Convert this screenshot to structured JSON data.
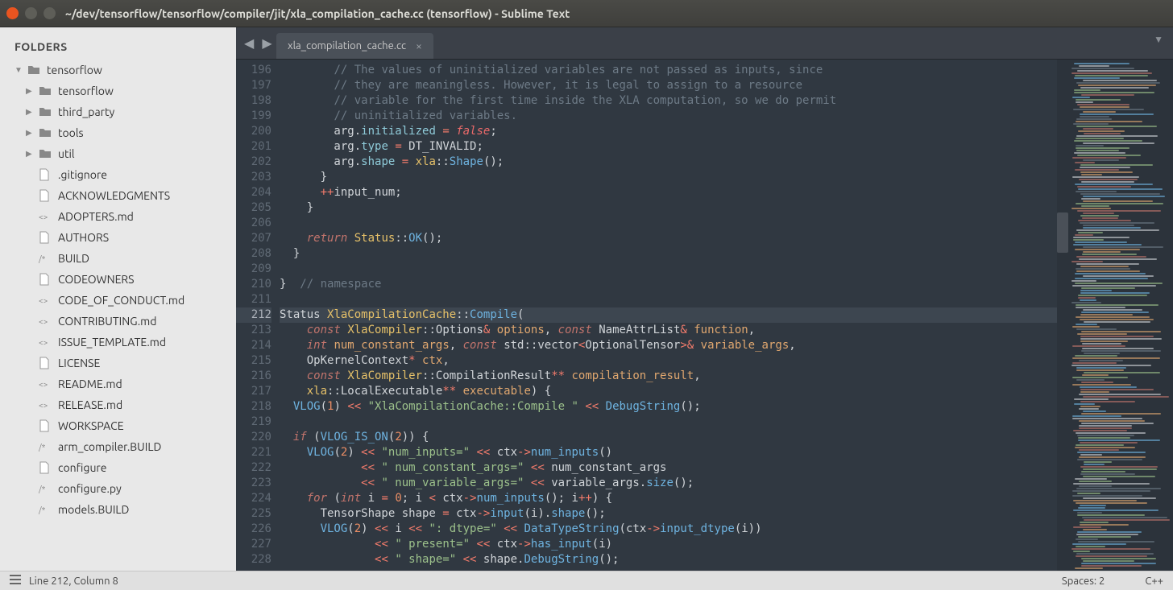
{
  "titlebar": {
    "text": "~/dev/tensorflow/tensorflow/compiler/jit/xla_compilation_cache.cc (tensorflow) - Sublime Text"
  },
  "sidebar": {
    "heading": "FOLDERS",
    "root": "tensorflow",
    "folders": [
      "tensorflow",
      "third_party",
      "tools",
      "util"
    ],
    "files": [
      {
        "name": ".gitignore",
        "icon": "file"
      },
      {
        "name": "ACKNOWLEDGMENTS",
        "icon": "file"
      },
      {
        "name": "ADOPTERS.md",
        "icon": "md"
      },
      {
        "name": "AUTHORS",
        "icon": "file"
      },
      {
        "name": "BUILD",
        "icon": "code"
      },
      {
        "name": "CODEOWNERS",
        "icon": "file"
      },
      {
        "name": "CODE_OF_CONDUCT.md",
        "icon": "md"
      },
      {
        "name": "CONTRIBUTING.md",
        "icon": "md"
      },
      {
        "name": "ISSUE_TEMPLATE.md",
        "icon": "md"
      },
      {
        "name": "LICENSE",
        "icon": "file"
      },
      {
        "name": "README.md",
        "icon": "md"
      },
      {
        "name": "RELEASE.md",
        "icon": "md"
      },
      {
        "name": "WORKSPACE",
        "icon": "file"
      },
      {
        "name": "arm_compiler.BUILD",
        "icon": "code"
      },
      {
        "name": "configure",
        "icon": "file"
      },
      {
        "name": "configure.py",
        "icon": "code"
      },
      {
        "name": "models.BUILD",
        "icon": "code"
      }
    ]
  },
  "tab": {
    "name": "xla_compilation_cache.cc"
  },
  "gutter": {
    "start": 196,
    "end": 228,
    "highlight": 212
  },
  "code": {
    "lines": [
      "        <span class='c-comment'>// The values of uninitialized variables are not passed as inputs, since</span>",
      "        <span class='c-comment'>// they are meaningless. However, it is legal to assign to a resource</span>",
      "        <span class='c-comment'>// variable for the first time inside the XLA computation, so we do permit</span>",
      "        <span class='c-comment'>// uninitialized variables.</span>",
      "        arg.<span class='c-prop'>initialized</span> <span class='c-op'>=</span> <span class='c-const'>false</span>;",
      "        arg.<span class='c-prop'>type</span> <span class='c-op'>=</span> DT_INVALID;",
      "        arg.<span class='c-prop'>shape</span> <span class='c-op'>=</span> <span class='c-class'>xla</span>::<span class='c-func'>Shape</span>();",
      "      }",
      "      <span class='c-op'>++</span>input_num;",
      "    }",
      "",
      "    <span class='c-kw'>return</span> <span class='c-class'>Status</span>::<span class='c-func'>OK</span>();",
      "  }",
      "",
      "}  <span class='c-comment'>// namespace</span>",
      "",
      "Status <span class='c-class'>XlaCompilationCache</span>::<span class='c-func'>Compile</span>(",
      "    <span class='c-kw'>const</span> <span class='c-class'>XlaCompiler</span>::Options<span class='c-op'>&</span> <span class='c-var'>options</span>, <span class='c-kw'>const</span> NameAttrList<span class='c-op'>&</span> <span class='c-var'>function</span>,",
      "    <span class='c-type'>int</span> <span class='c-var'>num_constant_args</span>, <span class='c-kw'>const</span> std::vector<span class='c-op'>&lt;</span>OptionalTensor<span class='c-op'>&gt;&amp;</span> <span class='c-var'>variable_args</span>,",
      "    OpKernelContext<span class='c-op'>*</span> <span class='c-var'>ctx</span>,",
      "    <span class='c-kw'>const</span> <span class='c-class'>XlaCompiler</span>::CompilationResult<span class='c-op'>**</span> <span class='c-var'>compilation_result</span>,",
      "    <span class='c-class'>xla</span>::LocalExecutable<span class='c-op'>**</span> <span class='c-var'>executable</span>) {",
      "  <span class='c-func'>VLOG</span>(<span class='c-num'>1</span>) <span class='c-op'>&lt;&lt;</span> <span class='c-str'>\"XlaCompilationCache::Compile \"</span> <span class='c-op'>&lt;&lt;</span> <span class='c-func'>DebugString</span>();",
      "",
      "  <span class='c-kw'>if</span> (<span class='c-func'>VLOG_IS_ON</span>(<span class='c-num'>2</span>)) {",
      "    <span class='c-func'>VLOG</span>(<span class='c-num'>2</span>) <span class='c-op'>&lt;&lt;</span> <span class='c-str'>\"num_inputs=\"</span> <span class='c-op'>&lt;&lt;</span> ctx<span class='c-op'>-&gt;</span><span class='c-func'>num_inputs</span>()",
      "            <span class='c-op'>&lt;&lt;</span> <span class='c-str'>\" num_constant_args=\"</span> <span class='c-op'>&lt;&lt;</span> num_constant_args",
      "            <span class='c-op'>&lt;&lt;</span> <span class='c-str'>\" num_variable_args=\"</span> <span class='c-op'>&lt;&lt;</span> variable_args.<span class='c-func'>size</span>();",
      "    <span class='c-kw'>for</span> (<span class='c-type'>int</span> i <span class='c-op'>=</span> <span class='c-num'>0</span>; i <span class='c-op'>&lt;</span> ctx<span class='c-op'>-&gt;</span><span class='c-func'>num_inputs</span>(); i<span class='c-op'>++</span>) {",
      "      TensorShape shape <span class='c-op'>=</span> ctx<span class='c-op'>-&gt;</span><span class='c-func'>input</span>(i).<span class='c-func'>shape</span>();",
      "      <span class='c-func'>VLOG</span>(<span class='c-num'>2</span>) <span class='c-op'>&lt;&lt;</span> i <span class='c-op'>&lt;&lt;</span> <span class='c-str'>\": dtype=\"</span> <span class='c-op'>&lt;&lt;</span> <span class='c-func'>DataTypeString</span>(ctx<span class='c-op'>-&gt;</span><span class='c-func'>input_dtype</span>(i))",
      "              <span class='c-op'>&lt;&lt;</span> <span class='c-str'>\" present=\"</span> <span class='c-op'>&lt;&lt;</span> ctx<span class='c-op'>-&gt;</span><span class='c-func'>has_input</span>(i)",
      "              <span class='c-op'>&lt;&lt;</span> <span class='c-str'>\" shape=\"</span> <span class='c-op'>&lt;&lt;</span> shape.<span class='c-func'>DebugString</span>();"
    ]
  },
  "statusbar": {
    "position": "Line 212, Column 8",
    "spaces": "Spaces: 2",
    "lang": "C++"
  }
}
